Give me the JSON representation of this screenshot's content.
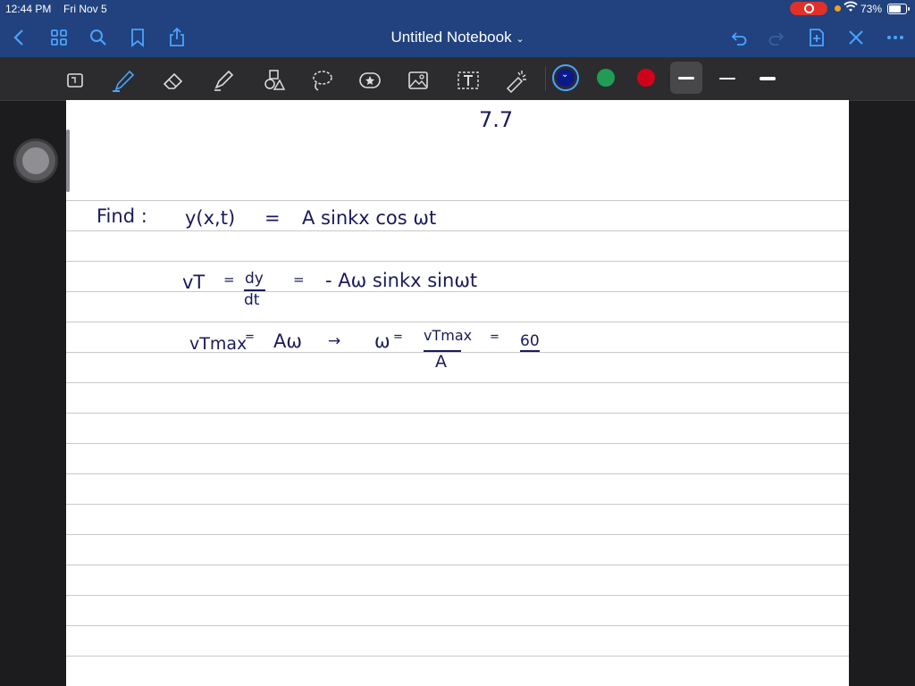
{
  "status_bar": {
    "time": "12:44 PM",
    "date": "Fri Nov 5",
    "battery": "73%"
  },
  "nav": {
    "title": "Untitled Notebook",
    "icons": [
      "back-icon",
      "thumbnails-icon",
      "search-icon",
      "bookmark-icon",
      "share-icon",
      "undo-icon",
      "redo-icon",
      "add-page-icon",
      "close-icon",
      "more-icon"
    ]
  },
  "toolbar": {
    "tools": [
      "lasso-zoom-icon",
      "pen-icon",
      "eraser-icon",
      "highlighter-icon",
      "shapes-icon",
      "lasso-icon",
      "sticker-icon",
      "image-icon",
      "text-icon",
      "laser-pointer-icon"
    ],
    "colors": {
      "active": "#0a1a8c",
      "green": "#1f9d55",
      "red": "#d0021b"
    },
    "active_tool": "pen"
  },
  "notes": {
    "section": "7.7",
    "find_label": "Find :",
    "eq1_lhs": "y(x,t)",
    "eq1_eq": "=",
    "eq1_rhs": "A sinkx cos ωt",
    "vt_label": "vT",
    "vt_eq": "=",
    "dy": "dy",
    "dt": "dt",
    "eq2_eq": "=",
    "eq2_rhs": "- Aω sinkx sinωt",
    "vmax": "vTmax",
    "vmax_eq": "=",
    "aw": "Aω",
    "arrow": "→",
    "omega": "ω",
    "omega_eq": "=",
    "frac_num": "vTmax",
    "frac_den": "A",
    "result_eq": "=",
    "result": "60"
  }
}
